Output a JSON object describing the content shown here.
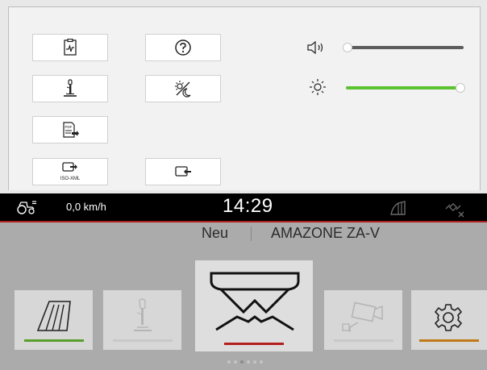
{
  "statusbar": {
    "speed": "0,0 km/h",
    "time": "14:29"
  },
  "workbar": {
    "profile": "Neu",
    "machine": "AMAZONE ZA-V"
  },
  "panel": {
    "buttons": [
      {
        "id": "diagnostics",
        "icon": "diagnostics-icon"
      },
      {
        "id": "help",
        "icon": "help-icon"
      },
      {
        "id": "service",
        "icon": "service-icon"
      },
      {
        "id": "day-night",
        "icon": "day-night-icon"
      },
      {
        "id": "pdf-export",
        "icon": "pdf-export-icon",
        "label": "PDF"
      },
      {
        "id": "isoxml-export",
        "icon": "isoxml-export-icon",
        "label": "ISO-XML"
      },
      {
        "id": "import",
        "icon": "import-icon"
      }
    ],
    "volume": {
      "icon": "speaker-icon",
      "level": 0.0
    },
    "brightness": {
      "icon": "sun-icon",
      "level": 1.0,
      "color": "#5dc232"
    }
  },
  "tiles": [
    {
      "id": "field",
      "icon": "field-icon",
      "active": true,
      "bar_color": "#5a9e2c"
    },
    {
      "id": "joystick",
      "icon": "joystick-icon",
      "active": false,
      "bar_color": "#c9c9c9"
    },
    {
      "id": "spreader",
      "icon": "spreader-icon",
      "active": true,
      "bar_color": "#b4201f"
    },
    {
      "id": "camera",
      "icon": "camera-icon",
      "active": false,
      "bar_color": "#c9c9c9"
    },
    {
      "id": "settings",
      "icon": "gear-icon",
      "active": true,
      "bar_color": "#c07a19"
    }
  ],
  "colors": {
    "accent_red": "#b0201c",
    "panel_bg": "#f2f2f2",
    "bottom_bg": "#ababab"
  }
}
